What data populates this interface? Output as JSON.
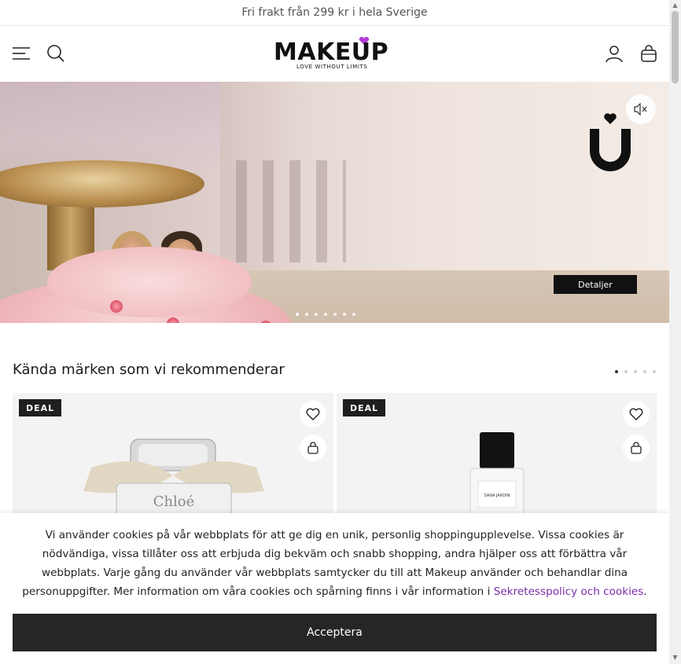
{
  "promo": {
    "text": "Fri frakt från 299 kr i hela Sverige"
  },
  "header": {
    "logo_text": "MAKEUP",
    "logo_tagline": "LOVE WITHOUT LIMITS",
    "icons": [
      "menu-icon",
      "search-icon",
      "account-icon",
      "bag-icon"
    ]
  },
  "hero": {
    "details_label": "Detaljer",
    "slides_count": 7,
    "active_slide": 0,
    "icons": [
      "mute-icon",
      "brand-heart-u-icon"
    ]
  },
  "section": {
    "title": "Kända märken som vi rekommenderar",
    "pages": 5,
    "active_page": 0
  },
  "cards": [
    {
      "badge": "DEAL",
      "product_brand_print": "Chloé"
    },
    {
      "badge": "DEAL",
      "product_brand_print": "SANA JARDIN"
    }
  ],
  "cookie": {
    "text": "Vi använder cookies på vår webbplats för att ge dig en unik, personlig shoppingupplevelse. Vissa cookies är nödvändiga, vissa tillåter oss att erbjuda dig bekväm och snabb shopping, andra hjälper oss att förbättra vår webbplats. Varje gång du använder vår webbplats samtycker du till att Makeup använder och behandlar dina personuppgifter. Mer information om våra cookies och spårning finns i vår information i ",
    "link_text": "Sekretesspolicy och cookies",
    "after_link": ".",
    "accept_label": "Acceptera"
  },
  "colors": {
    "accent_purple": "#7a2ba8",
    "logo_heart": "#b23ad6",
    "dark_button": "#262626"
  }
}
